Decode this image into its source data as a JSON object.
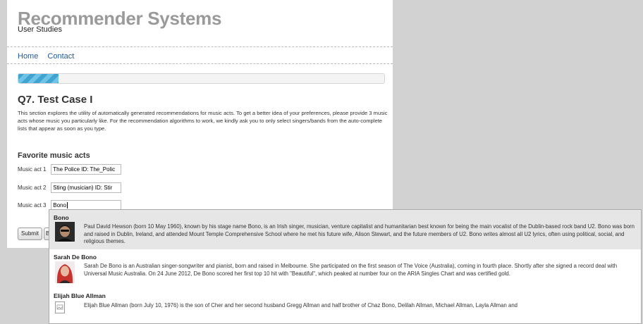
{
  "header": {
    "title": "Recommender Systems",
    "subtitle": "User Studies"
  },
  "nav": {
    "home": "Home",
    "contact": "Contact"
  },
  "progress": {
    "fraction": 0.11
  },
  "question": {
    "title": "Q7. Test Case I",
    "intro": "This section explores the utility of automatically generated recommendations for music acts. To get a better idea of your preferences, please provide 3 music acts whose music you particularly like. For the recommendation algorithms to work, we kindly ask you to only select singers/bands from the auto-complete lists that appear as soon as you type."
  },
  "form": {
    "section_title": "Favorite music acts",
    "fields": [
      {
        "label": "Music act 1",
        "value": "The Police ID: The_Polic"
      },
      {
        "label": "Music act 2",
        "value": "Sting (musician) ID: Stir"
      },
      {
        "label": "Music act 3",
        "value": "Bono"
      }
    ],
    "submit_label": "Submit",
    "back_label": "B"
  },
  "autocomplete": [
    {
      "name": "Bono",
      "thumb": "bono-portrait",
      "desc": "Paul David Hewson (born 10 May 1960), known by his stage name Bono, is an Irish singer, musician, venture capitalist and humanitarian best known for being the main vocalist of the Dublin-based rock band U2. Bono was born and raised in Dublin, Ireland, and attended Mount Temple Comprehensive School where he met his future wife, Alison Stewart, and the future members of U2. Bono writes almost all U2 lyrics, often using political, social, and religious themes."
    },
    {
      "name": "Sarah De Bono",
      "thumb": "sarah-de-bono-portrait",
      "desc": "Sarah De Bono is an Australian singer-songwriter and pianist, born and raised in Melbourne. She participated on the first season of The Voice (Australia), coming in fourth place. Shortly after she signed a record deal with Universal Music Australia. On 24 June 2012, De Bono scored her first top 10 hit with \"Beautiful\", which peaked at number four on the ARIA Singles Chart and was certified gold."
    },
    {
      "name": "Elijah Blue Allman",
      "thumb": "image-placeholder-icon",
      "desc": "Elijah Blue Allman (born July 10, 1976) is the son of Cher and her second husband Gregg Allman and half brother of Chaz Bono, Delilah Allman, Michael Allman, Layla Allman and"
    }
  ]
}
